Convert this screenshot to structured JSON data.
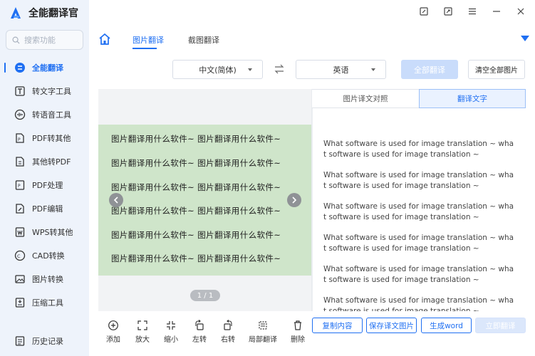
{
  "app": {
    "title": "全能翻译官",
    "brand_color": "#1f6ff2"
  },
  "search": {
    "placeholder": "搜索功能"
  },
  "sidebar": {
    "items": [
      {
        "label": "全能翻译",
        "icon": "translate-icon",
        "active": true
      },
      {
        "label": "转文字工具",
        "icon": "text-tool-icon"
      },
      {
        "label": "转语音工具",
        "icon": "voice-tool-icon"
      },
      {
        "label": "PDF转其他",
        "icon": "pdf-convert-icon"
      },
      {
        "label": "其他转PDF",
        "icon": "to-pdf-icon"
      },
      {
        "label": "PDF处理",
        "icon": "pdf-process-icon"
      },
      {
        "label": "PDF编辑",
        "icon": "pdf-edit-icon"
      },
      {
        "label": "WPS转其他",
        "icon": "wps-icon"
      },
      {
        "label": "CAD转换",
        "icon": "cad-icon"
      },
      {
        "label": "图片转换",
        "icon": "image-convert-icon"
      },
      {
        "label": "压缩工具",
        "icon": "compress-icon"
      }
    ],
    "history": "历史记录"
  },
  "tabs": {
    "image_translate": "图片翻译",
    "screenshot_translate": "截图翻译"
  },
  "languages": {
    "source": "中文(简体)",
    "target": "英语"
  },
  "buttons": {
    "translate_all": "全部翻译",
    "clear_all": "清空全部图片",
    "copy": "复制内容",
    "save_image": "保存译文图片",
    "generate_word": "生成word",
    "translate_now": "立即翻译"
  },
  "image": {
    "lines": [
      "图片翻译用什么软件~ 图片翻译用什么软件~",
      "图片翻译用什么软件~ 图片翻译用什么软件~",
      "图片翻译用什么软件~ 图片翻译用什么软件~",
      "图片翻译用什么软件~ 图片翻译用什么软件~",
      "图片翻译用什么软件~ 图片翻译用什么软件~",
      "图片翻译用什么软件~ 图片翻译用什么软件~"
    ],
    "pager": "1 / 1"
  },
  "result_tabs": {
    "compare": "图片译文对照",
    "text": "翻译文字"
  },
  "translations": [
    "What software is used for image translation ~ what software is used for image translation ~",
    "What software is used for image translation ~ what software is used for image translation ~",
    "What software is used for image translation ~ what software is used for image translation ~",
    "What software is used for image translation ~ what software is used for image translation ~",
    "What software is used for image translation ~ what software is used for image translation ~",
    "What software is used for image translation ~ what software is used for image translation ~"
  ],
  "tools": [
    {
      "label": "添加",
      "icon": "add-icon"
    },
    {
      "label": "放大",
      "icon": "zoom-in-icon"
    },
    {
      "label": "缩小",
      "icon": "zoom-out-icon"
    },
    {
      "label": "左转",
      "icon": "rotate-left-icon"
    },
    {
      "label": "右转",
      "icon": "rotate-right-icon"
    },
    {
      "label": "局部翻译",
      "icon": "partial-translate-icon"
    },
    {
      "label": "删除",
      "icon": "delete-icon"
    }
  ]
}
